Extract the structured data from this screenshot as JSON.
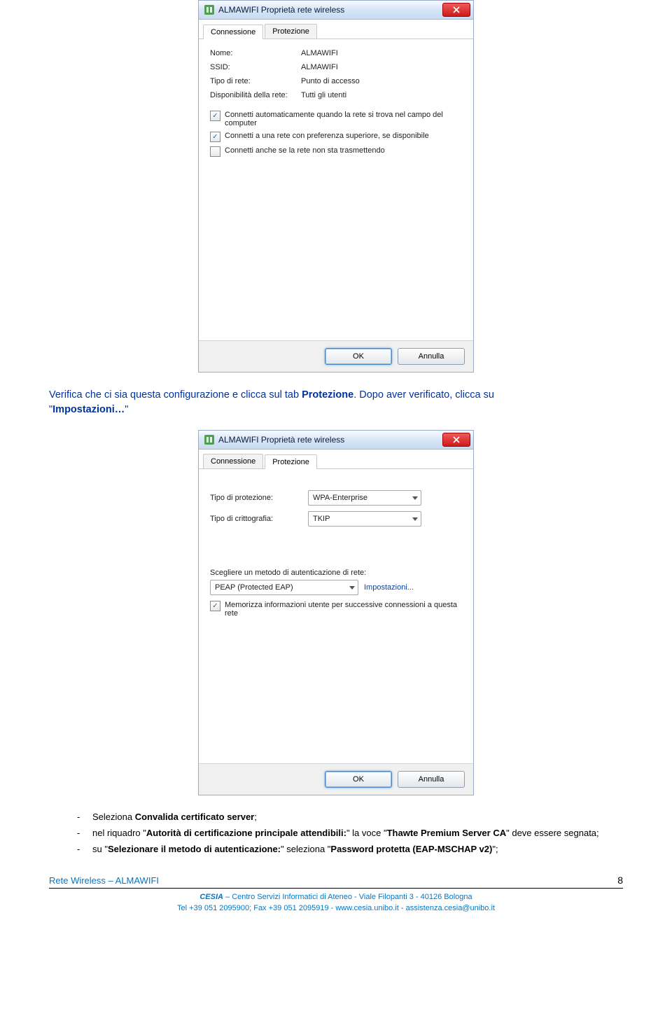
{
  "dialog1": {
    "title": "ALMAWIFI Proprietà rete wireless",
    "tabs": {
      "tab1": "Connessione",
      "tab2": "Protezione"
    },
    "labels": {
      "nome": "Nome:",
      "ssid": "SSID:",
      "tipo": "Tipo di rete:",
      "disp": "Disponibilità della rete:"
    },
    "values": {
      "nome": "ALMAWIFI",
      "ssid": "ALMAWIFI",
      "tipo": "Punto di accesso",
      "disp": "Tutti gli utenti"
    },
    "checks": {
      "c1": "Connetti automaticamente quando la rete si trova nel campo del computer",
      "c2": "Connetti a una rete con preferenza superiore, se disponibile",
      "c3": "Connetti anche se la rete non sta trasmettendo"
    },
    "buttons": {
      "ok": "OK",
      "cancel": "Annulla"
    }
  },
  "midtext": {
    "line1a": "Verifica che ci sia questa configurazione e clicca sul tab ",
    "line1b": "Protezione",
    "line1c": ". Dopo aver verificato, clicca su",
    "line2a": "\"",
    "line2b": "Impostazioni…",
    "line2c": "\""
  },
  "dialog2": {
    "title": "ALMAWIFI Proprietà rete wireless",
    "tabs": {
      "tab1": "Connessione",
      "tab2": "Protezione"
    },
    "labels": {
      "tipoprot": "Tipo di protezione:",
      "tipocrit": "Tipo di crittografia:",
      "scegliere": "Scegliere un metodo di autenticazione di rete:"
    },
    "values": {
      "tipoprot": "WPA-Enterprise",
      "tipocrit": "TKIP",
      "metodo": "PEAP (Protected EAP)",
      "impost": "Impostazioni..."
    },
    "checks": {
      "mem": "Memorizza informazioni utente per successive connessioni a questa rete"
    },
    "buttons": {
      "ok": "OK",
      "cancel": "Annulla"
    }
  },
  "bullets": {
    "b1a": "Seleziona ",
    "b1b": "Convalida certificato server",
    "b1c": ";",
    "b2a": "nel riquadro \"",
    "b2b": "Autorità di certificazione principale attendibili:",
    "b2c": "\" la voce \"",
    "b2d": "Thawte Premium Server CA",
    "b2e": "\" deve essere segnata;",
    "b3a": "su \"",
    "b3b": "Selezionare il metodo di autenticazione:",
    "b3c": "\" seleziona \"",
    "b3d": "Password protetta (EAP-MSCHAP v2)",
    "b3e": "\";"
  },
  "footer": {
    "left": "Rete Wireless – ALMAWIFI",
    "page": "8",
    "org": "CESIA",
    "orgrest": " – Centro Servizi Informatici di Ateneo - Viale Filopanti 3 - 40126 Bologna",
    "contact": "Tel +39 051 2095900; Fax +39 051 2095919 - www.cesia.unibo.it - assistenza.cesia@unibo.it"
  }
}
